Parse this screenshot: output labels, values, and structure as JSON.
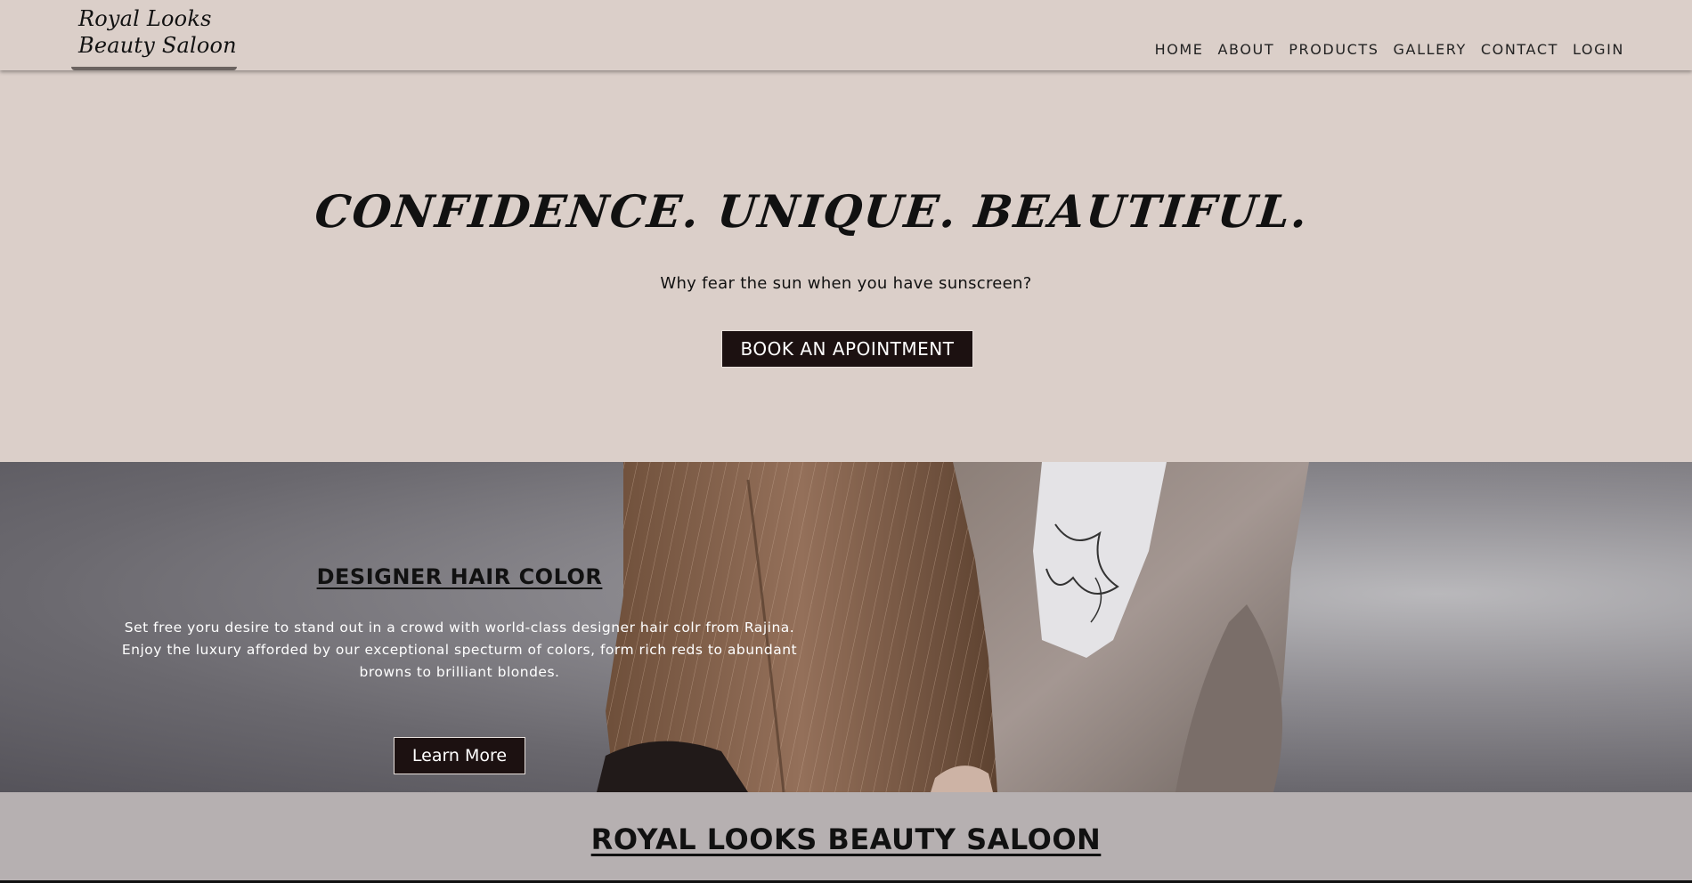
{
  "logo": {
    "line1": "Royal Looks",
    "line2": "Beauty Saloon"
  },
  "nav": {
    "items": [
      "HOME",
      "ABOUT",
      "PRODUCTS",
      "GALLERY",
      "CONTACT",
      "LOGIN"
    ]
  },
  "hero": {
    "title": "CONFIDENCE. UNIQUE. BEAUTIFUL.",
    "subtitle": "Why fear the sun when you have sunscreen?",
    "button": "BOOK AN APOINTMENT"
  },
  "banner": {
    "title": "DESIGNER HAIR COLOR",
    "text": "Set free yoru desire to stand out in a crowd with world-class designer hair colr from Rajina. Enjoy the luxury afforded by our exceptional specturm of colors, form rich reds to abundant browns to brilliant blondes.",
    "button": "Learn More"
  },
  "footer": {
    "title": "ROYAL LOOKS BEAUTY SALOON"
  },
  "colors": {
    "page_bg": "#dbcfc9",
    "button_bg": "#1c1111",
    "footer_bg": "#b6b0b1"
  }
}
